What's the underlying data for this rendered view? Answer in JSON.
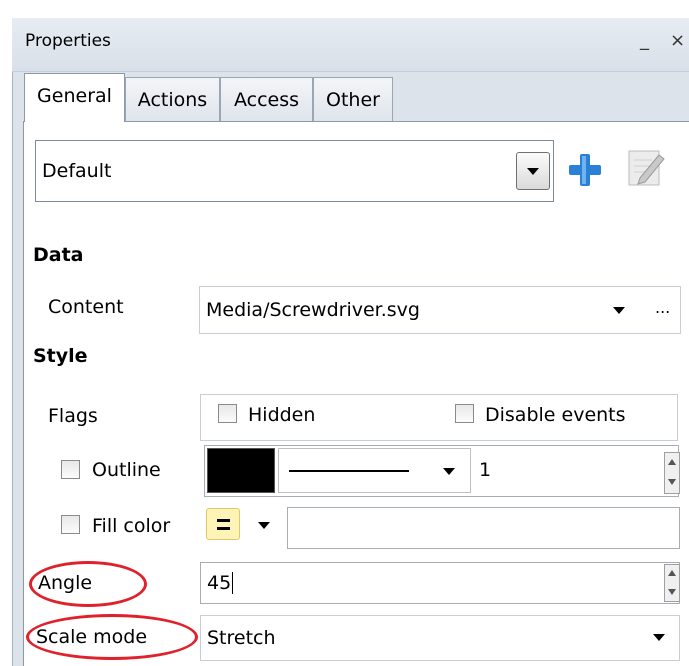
{
  "window": {
    "title": "Properties",
    "minimize": "_",
    "close": "×"
  },
  "tabs": [
    "General",
    "Actions",
    "Access",
    "Other"
  ],
  "preset": {
    "value": "Default",
    "icons": [
      "add-icon",
      "edit-icon"
    ]
  },
  "sections": {
    "data": "Data",
    "style": "Style"
  },
  "content": {
    "label": "Content",
    "value": "Media/Screwdriver.svg",
    "browse": "..."
  },
  "flags": {
    "label": "Flags",
    "hidden_label": "Hidden",
    "hidden_checked": false,
    "disable_events_label": "Disable events",
    "disable_events_checked": false
  },
  "outline": {
    "label": "Outline",
    "checked": false,
    "color": "#000000",
    "width": "1"
  },
  "fill": {
    "label": "Fill color",
    "checked": false,
    "value": ""
  },
  "angle": {
    "label": "Angle",
    "value": "45"
  },
  "scale_mode": {
    "label": "Scale mode",
    "value": "Stretch"
  },
  "colors": {
    "highlight": "#e0202a",
    "accent": "#2a7fd6"
  }
}
